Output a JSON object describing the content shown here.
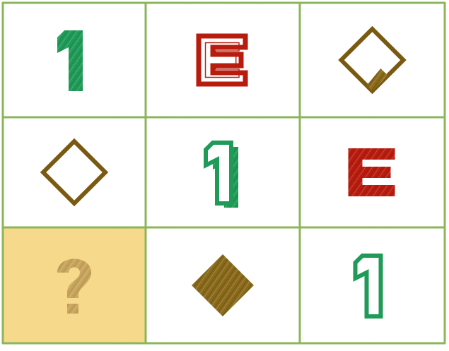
{
  "puzzle": {
    "grid_line_color": "#8bb65a",
    "highlight_color": "#f7d98b",
    "colors": {
      "green": "#1f9a57",
      "green_dark": "#137a43",
      "red": "#b81c0e",
      "red_dark": "#8f1208",
      "brown": "#7a5a12",
      "brown_fill": "#8a6a1a",
      "question": "#c4a15a"
    },
    "cells": [
      {
        "row": 0,
        "col": 0,
        "symbol": "1",
        "style": "solid",
        "color": "green",
        "interactable": false
      },
      {
        "row": 0,
        "col": 1,
        "symbol": "E",
        "style": "double-outline",
        "color": "red",
        "interactable": false
      },
      {
        "row": 0,
        "col": 2,
        "symbol": "diamond",
        "style": "outline-partial-fill",
        "color": "brown",
        "interactable": false
      },
      {
        "row": 1,
        "col": 0,
        "symbol": "diamond",
        "style": "outline",
        "color": "brown",
        "interactable": false
      },
      {
        "row": 1,
        "col": 1,
        "symbol": "1",
        "style": "outline-shadow",
        "color": "green",
        "interactable": false
      },
      {
        "row": 1,
        "col": 2,
        "symbol": "E",
        "style": "solid",
        "color": "red",
        "interactable": false
      },
      {
        "row": 2,
        "col": 0,
        "symbol": "?",
        "style": "question",
        "color": "question",
        "interactable": true
      },
      {
        "row": 2,
        "col": 1,
        "symbol": "diamond",
        "style": "solid",
        "color": "brown",
        "interactable": false
      },
      {
        "row": 2,
        "col": 2,
        "symbol": "1",
        "style": "outline",
        "color": "green",
        "interactable": false
      }
    ]
  }
}
